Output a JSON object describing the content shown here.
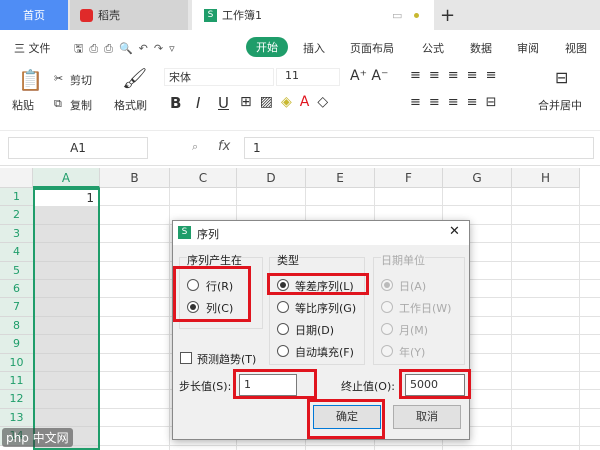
{
  "tabs": [
    {
      "label": "首页",
      "active": false
    },
    {
      "label": "稻壳",
      "active": false
    },
    {
      "label": "工作簿1",
      "active": true
    }
  ],
  "new_tab": "+",
  "menu": {
    "file": "三 文件",
    "items": [
      "开始",
      "插入",
      "页面布局",
      "公式",
      "数据",
      "审阅",
      "视图"
    ],
    "active": "开始"
  },
  "toolbar": {
    "paste": "粘贴",
    "cut": "剪切",
    "copy": "复制",
    "format_painter": "格式刷",
    "font_name": "宋体",
    "font_size": "11",
    "merge": "合并居中",
    "bold": "B",
    "italic": "I",
    "underline": "U"
  },
  "formula_bar": {
    "cell_ref": "A1",
    "fx": "fx",
    "value": "1"
  },
  "columns": [
    "A",
    "B",
    "C",
    "D",
    "E",
    "F",
    "G",
    "H"
  ],
  "rows": [
    "1",
    "2",
    "3",
    "4",
    "5",
    "6",
    "7",
    "8",
    "9",
    "10",
    "11",
    "12",
    "13",
    "14"
  ],
  "cell_a1": "1",
  "dialog": {
    "title": "序列",
    "close": "✕",
    "series_in": {
      "label": "序列产生在",
      "options": [
        "行(R)",
        "列(C)"
      ],
      "selected": "列(C)"
    },
    "type": {
      "label": "类型",
      "options": [
        "等差序列(L)",
        "等比序列(G)",
        "日期(D)",
        "自动填充(F)"
      ],
      "selected": "等差序列(L)"
    },
    "date_unit": {
      "label": "日期单位",
      "options": [
        "日(A)",
        "工作日(W)",
        "月(M)",
        "年(Y)"
      ],
      "selected": "日(A)"
    },
    "trend": "预测趋势(T)",
    "step_label": "步长值(S):",
    "step_value": "1",
    "stop_label": "终止值(O):",
    "stop_value": "5000",
    "ok": "确定",
    "cancel": "取消"
  },
  "watermark": "php 中文网",
  "colors": {
    "accent": "#1f9d6a",
    "highlight": "#e0141e",
    "tab_home": "#4f8df5"
  }
}
